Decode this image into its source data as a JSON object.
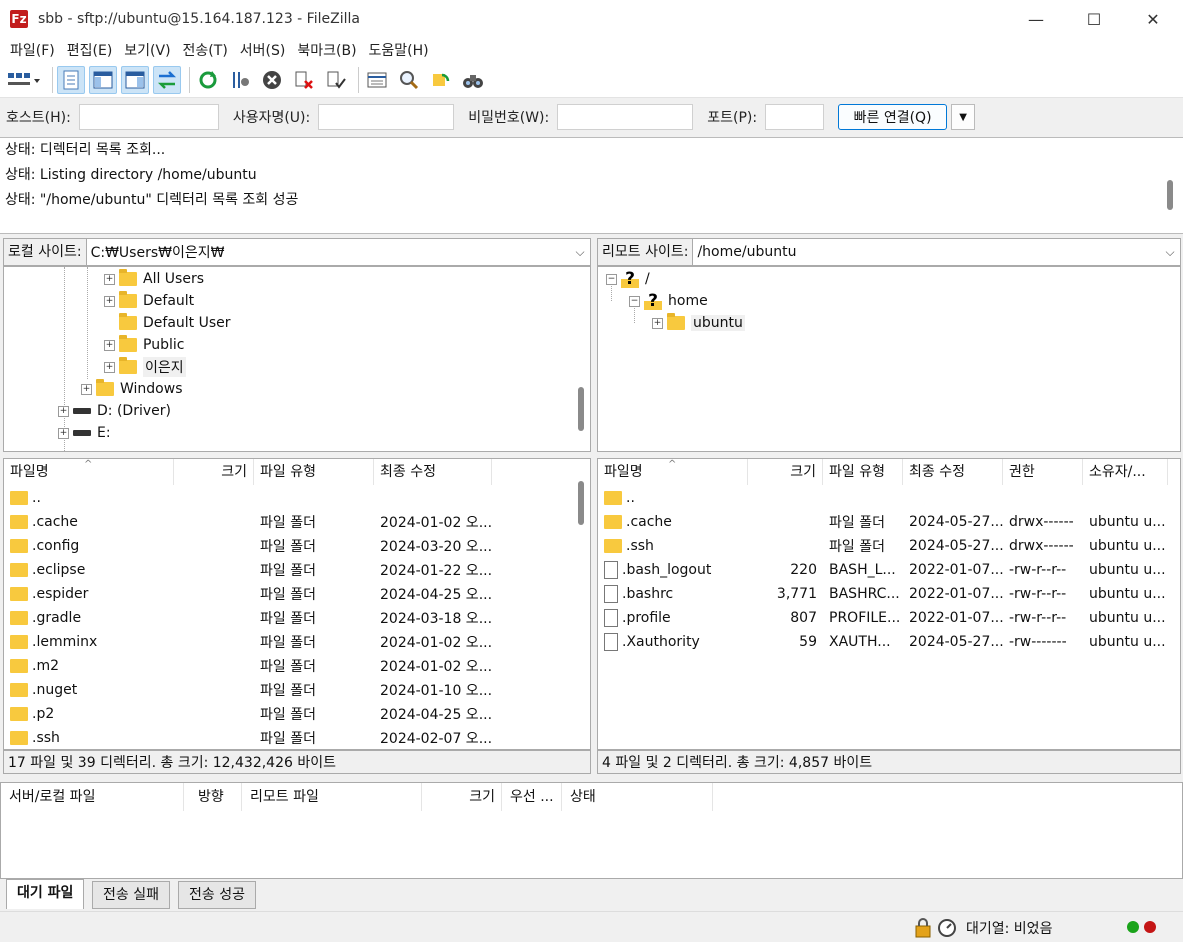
{
  "window": {
    "title": "sbb - sftp://ubuntu@15.164.187.123 - FileZilla",
    "app_icon_text": "Fz",
    "minimize_glyph": "—",
    "maximize_glyph": "☐",
    "close_glyph": "✕"
  },
  "menu": [
    "파일(F)",
    "편집(E)",
    "보기(V)",
    "전송(T)",
    "서버(S)",
    "북마크(B)",
    "도움말(H)"
  ],
  "quickconnect": {
    "host_label": "호스트(H):",
    "host_value": "",
    "user_label": "사용자명(U):",
    "user_value": "",
    "pass_label": "비밀번호(W):",
    "pass_value": "",
    "port_label": "포트(P):",
    "port_value": "",
    "connect_label": "빠른 연결(Q)",
    "dropdown_glyph": "▼"
  },
  "log": [
    "상태:  디렉터리 목록 조회...",
    "상태:  Listing directory /home/ubuntu",
    "상태:  \"/home/ubuntu\" 디렉터리 목록 조회 성공"
  ],
  "local": {
    "site_label": "로컬 사이트:",
    "path": "C:₩Users₩이은지₩",
    "tree": [
      {
        "name": "All Users",
        "expander": "+"
      },
      {
        "name": "Default",
        "expander": "+"
      },
      {
        "name": "Default User",
        "expander": ""
      },
      {
        "name": "Public",
        "expander": "+"
      },
      {
        "name": "이은지",
        "expander": "+",
        "selected": true
      },
      {
        "name": "Windows",
        "expander": "+"
      },
      {
        "name": "D: (Driver)",
        "expander": "+",
        "drive": true
      },
      {
        "name": "E:",
        "expander": "+",
        "drive": true
      }
    ],
    "columns": [
      "파일명",
      "크기",
      "파일 유형",
      "최종 수정"
    ],
    "sort_glyph": "^",
    "files": [
      {
        "name": "..",
        "size": "",
        "type": "",
        "modified": ""
      },
      {
        "name": ".cache",
        "size": "",
        "type": "파일 폴더",
        "modified": "2024-01-02 오..."
      },
      {
        "name": ".config",
        "size": "",
        "type": "파일 폴더",
        "modified": "2024-03-20 오..."
      },
      {
        "name": ".eclipse",
        "size": "",
        "type": "파일 폴더",
        "modified": "2024-01-22 오..."
      },
      {
        "name": ".espider",
        "size": "",
        "type": "파일 폴더",
        "modified": "2024-04-25 오..."
      },
      {
        "name": ".gradle",
        "size": "",
        "type": "파일 폴더",
        "modified": "2024-03-18 오..."
      },
      {
        "name": ".lemminx",
        "size": "",
        "type": "파일 폴더",
        "modified": "2024-01-02 오..."
      },
      {
        "name": ".m2",
        "size": "",
        "type": "파일 폴더",
        "modified": "2024-01-02 오..."
      },
      {
        "name": ".nuget",
        "size": "",
        "type": "파일 폴더",
        "modified": "2024-01-10 오..."
      },
      {
        "name": ".p2",
        "size": "",
        "type": "파일 폴더",
        "modified": "2024-04-25 오..."
      },
      {
        "name": ".ssh",
        "size": "",
        "type": "파일 폴더",
        "modified": "2024-02-07 오..."
      }
    ],
    "status": "17 파일 및 39 디렉터리. 총 크기: 12,432,426 바이트"
  },
  "remote": {
    "site_label": "리모트 사이트:",
    "path": "/home/ubuntu",
    "tree": [
      {
        "name": "/",
        "expander": "−",
        "unknown": true
      },
      {
        "name": "home",
        "expander": "−",
        "unknown": true
      },
      {
        "name": "ubuntu",
        "expander": "+",
        "selected": true
      }
    ],
    "columns": [
      "파일명",
      "크기",
      "파일 유형",
      "최종 수정",
      "권한",
      "소유자/..."
    ],
    "sort_glyph": "^",
    "files": [
      {
        "name": "..",
        "size": "",
        "type": "",
        "modified": "",
        "perms": "",
        "owner": "",
        "kind": "folder"
      },
      {
        "name": ".cache",
        "size": "",
        "type": "파일 폴더",
        "modified": "2024-05-27...",
        "perms": "drwx------",
        "owner": "ubuntu u...",
        "kind": "folder"
      },
      {
        "name": ".ssh",
        "size": "",
        "type": "파일 폴더",
        "modified": "2024-05-27...",
        "perms": "drwx------",
        "owner": "ubuntu u...",
        "kind": "folder"
      },
      {
        "name": ".bash_logout",
        "size": "220",
        "type": "BASH_L...",
        "modified": "2022-01-07...",
        "perms": "-rw-r--r--",
        "owner": "ubuntu u...",
        "kind": "file"
      },
      {
        "name": ".bashrc",
        "size": "3,771",
        "type": "BASHRC...",
        "modified": "2022-01-07...",
        "perms": "-rw-r--r--",
        "owner": "ubuntu u...",
        "kind": "file"
      },
      {
        "name": ".profile",
        "size": "807",
        "type": "PROFILE...",
        "modified": "2022-01-07...",
        "perms": "-rw-r--r--",
        "owner": "ubuntu u...",
        "kind": "file"
      },
      {
        "name": ".Xauthority",
        "size": "59",
        "type": "XAUTH...",
        "modified": "2024-05-27...",
        "perms": "-rw-------",
        "owner": "ubuntu u...",
        "kind": "file"
      }
    ],
    "status": "4 파일 및 2 디렉터리. 총 크기: 4,857 바이트"
  },
  "queue": {
    "columns": [
      "서버/로컬 파일",
      "방향",
      "리모트 파일",
      "크기",
      "우선 ...",
      "상태"
    ]
  },
  "tabs": [
    "대기 파일",
    "전송 실패",
    "전송 성공"
  ],
  "statusbar": {
    "queue_text": "대기열: 비었음",
    "led_colors": [
      "#1aa31a",
      "#c41515"
    ]
  }
}
